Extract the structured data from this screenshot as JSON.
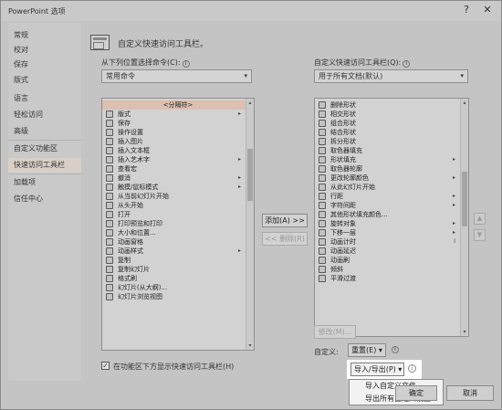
{
  "window": {
    "title": "PowerPoint 选项",
    "help_glyph": "?",
    "close_glyph": "✕"
  },
  "nav": {
    "items": [
      {
        "label": "常规"
      },
      {
        "label": "校对"
      },
      {
        "label": "保存"
      },
      {
        "label": "版式"
      },
      {
        "label": "语言"
      },
      {
        "label": "轻松访问"
      },
      {
        "label": "高级"
      },
      {
        "label": "自定义功能区"
      },
      {
        "label": "快速访问工具栏"
      },
      {
        "label": "加载项"
      },
      {
        "label": "信任中心"
      }
    ],
    "active_index": 8
  },
  "main": {
    "header": "自定义快速访问工具栏。",
    "choose_label": "从下列位置选择命令(C):",
    "choose_value": "常用命令",
    "customize_label": "自定义快速访问工具栏(Q):",
    "customize_value": "用于所有文档(默认)",
    "info_glyph": "i",
    "dropdown_glyph": "▾",
    "submenu_glyph": "▸",
    "scroll_up_glyph": "▴",
    "scroll_down_glyph": "▾",
    "left_list": [
      {
        "label": "<分隔符>",
        "selected": true
      },
      {
        "label": "版式",
        "sub": "▸"
      },
      {
        "label": "保存"
      },
      {
        "label": "操作设置"
      },
      {
        "label": "插入图片"
      },
      {
        "label": "插入文本框"
      },
      {
        "label": "插入艺术字",
        "sub": "▸"
      },
      {
        "label": "查看宏"
      },
      {
        "label": "撤消",
        "sub": "▸"
      },
      {
        "label": "触摸/鼠标模式",
        "sub": "▸"
      },
      {
        "label": "从当前幻灯片开始"
      },
      {
        "label": "从头开始"
      },
      {
        "label": "打开"
      },
      {
        "label": "打印预览和打印"
      },
      {
        "label": "大小和位置..."
      },
      {
        "label": "动画窗格"
      },
      {
        "label": "动画样式",
        "sub": "▸"
      },
      {
        "label": "复制"
      },
      {
        "label": "复制幻灯片"
      },
      {
        "label": "格式刷"
      },
      {
        "label": "幻灯片(从大纲)..."
      },
      {
        "label": "幻灯片浏览视图"
      }
    ],
    "right_list": [
      {
        "label": "删除形状"
      },
      {
        "label": "相交形状"
      },
      {
        "label": "组合形状"
      },
      {
        "label": "结合形状"
      },
      {
        "label": "拆分形状"
      },
      {
        "label": "取色器填充"
      },
      {
        "label": "形状填充",
        "sub": "▸"
      },
      {
        "label": "取色器轮廓"
      },
      {
        "label": "更改轮廓颜色",
        "sub": "▸"
      },
      {
        "label": "从此幻灯片开始"
      },
      {
        "label": "行距",
        "sub": "▸"
      },
      {
        "label": "字符间距",
        "sub": "▸"
      },
      {
        "label": "其他形状填充颜色..."
      },
      {
        "label": "旋转对象",
        "sub": "▸"
      },
      {
        "label": "下移一层",
        "sub": "▸"
      },
      {
        "label": "动画计时",
        "sub": "I"
      },
      {
        "label": "动画延迟"
      },
      {
        "label": "动画刷"
      },
      {
        "label": "倾斜"
      },
      {
        "label": "平滑过渡"
      }
    ],
    "add_button": "添加(A) >>",
    "remove_button": "<< 删除(R)",
    "modify_button": "修改(M)...",
    "customize_label2": "自定义:",
    "reset_button": "重置(E) ▾",
    "checkbox_label": "在功能区下方显示快速访问工具栏(H)",
    "checkbox_checked": true,
    "checkbox_mark": "✓",
    "import_export_button": "导入/导出(P) ▾",
    "move_up_glyph": "▲",
    "move_down_glyph": "▼"
  },
  "import_menu": {
    "items": [
      {
        "label": "导入自定义文件"
      },
      {
        "label": "导出所有自定义设置"
      }
    ]
  },
  "footer": {
    "ok_label": "确定",
    "cancel_label": "取消"
  }
}
